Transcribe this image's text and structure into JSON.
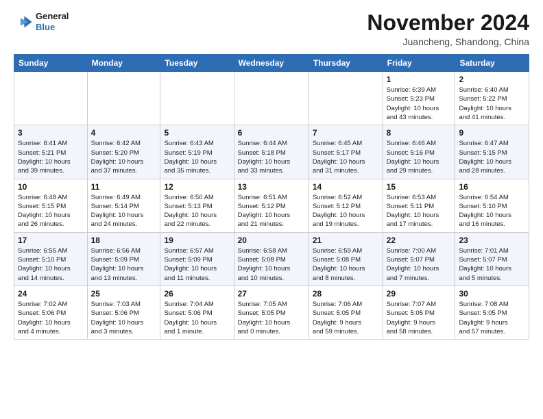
{
  "logo": {
    "line1": "General",
    "line2": "Blue"
  },
  "header": {
    "month": "November 2024",
    "location": "Juancheng, Shandong, China"
  },
  "weekdays": [
    "Sunday",
    "Monday",
    "Tuesday",
    "Wednesday",
    "Thursday",
    "Friday",
    "Saturday"
  ],
  "weeks": [
    [
      {
        "day": "",
        "info": ""
      },
      {
        "day": "",
        "info": ""
      },
      {
        "day": "",
        "info": ""
      },
      {
        "day": "",
        "info": ""
      },
      {
        "day": "",
        "info": ""
      },
      {
        "day": "1",
        "info": "Sunrise: 6:39 AM\nSunset: 5:23 PM\nDaylight: 10 hours\nand 43 minutes."
      },
      {
        "day": "2",
        "info": "Sunrise: 6:40 AM\nSunset: 5:22 PM\nDaylight: 10 hours\nand 41 minutes."
      }
    ],
    [
      {
        "day": "3",
        "info": "Sunrise: 6:41 AM\nSunset: 5:21 PM\nDaylight: 10 hours\nand 39 minutes."
      },
      {
        "day": "4",
        "info": "Sunrise: 6:42 AM\nSunset: 5:20 PM\nDaylight: 10 hours\nand 37 minutes."
      },
      {
        "day": "5",
        "info": "Sunrise: 6:43 AM\nSunset: 5:19 PM\nDaylight: 10 hours\nand 35 minutes."
      },
      {
        "day": "6",
        "info": "Sunrise: 6:44 AM\nSunset: 5:18 PM\nDaylight: 10 hours\nand 33 minutes."
      },
      {
        "day": "7",
        "info": "Sunrise: 6:45 AM\nSunset: 5:17 PM\nDaylight: 10 hours\nand 31 minutes."
      },
      {
        "day": "8",
        "info": "Sunrise: 6:46 AM\nSunset: 5:16 PM\nDaylight: 10 hours\nand 29 minutes."
      },
      {
        "day": "9",
        "info": "Sunrise: 6:47 AM\nSunset: 5:15 PM\nDaylight: 10 hours\nand 28 minutes."
      }
    ],
    [
      {
        "day": "10",
        "info": "Sunrise: 6:48 AM\nSunset: 5:15 PM\nDaylight: 10 hours\nand 26 minutes."
      },
      {
        "day": "11",
        "info": "Sunrise: 6:49 AM\nSunset: 5:14 PM\nDaylight: 10 hours\nand 24 minutes."
      },
      {
        "day": "12",
        "info": "Sunrise: 6:50 AM\nSunset: 5:13 PM\nDaylight: 10 hours\nand 22 minutes."
      },
      {
        "day": "13",
        "info": "Sunrise: 6:51 AM\nSunset: 5:12 PM\nDaylight: 10 hours\nand 21 minutes."
      },
      {
        "day": "14",
        "info": "Sunrise: 6:52 AM\nSunset: 5:12 PM\nDaylight: 10 hours\nand 19 minutes."
      },
      {
        "day": "15",
        "info": "Sunrise: 6:53 AM\nSunset: 5:11 PM\nDaylight: 10 hours\nand 17 minutes."
      },
      {
        "day": "16",
        "info": "Sunrise: 6:54 AM\nSunset: 5:10 PM\nDaylight: 10 hours\nand 16 minutes."
      }
    ],
    [
      {
        "day": "17",
        "info": "Sunrise: 6:55 AM\nSunset: 5:10 PM\nDaylight: 10 hours\nand 14 minutes."
      },
      {
        "day": "18",
        "info": "Sunrise: 6:56 AM\nSunset: 5:09 PM\nDaylight: 10 hours\nand 13 minutes."
      },
      {
        "day": "19",
        "info": "Sunrise: 6:57 AM\nSunset: 5:09 PM\nDaylight: 10 hours\nand 11 minutes."
      },
      {
        "day": "20",
        "info": "Sunrise: 6:58 AM\nSunset: 5:08 PM\nDaylight: 10 hours\nand 10 minutes."
      },
      {
        "day": "21",
        "info": "Sunrise: 6:59 AM\nSunset: 5:08 PM\nDaylight: 10 hours\nand 8 minutes."
      },
      {
        "day": "22",
        "info": "Sunrise: 7:00 AM\nSunset: 5:07 PM\nDaylight: 10 hours\nand 7 minutes."
      },
      {
        "day": "23",
        "info": "Sunrise: 7:01 AM\nSunset: 5:07 PM\nDaylight: 10 hours\nand 5 minutes."
      }
    ],
    [
      {
        "day": "24",
        "info": "Sunrise: 7:02 AM\nSunset: 5:06 PM\nDaylight: 10 hours\nand 4 minutes."
      },
      {
        "day": "25",
        "info": "Sunrise: 7:03 AM\nSunset: 5:06 PM\nDaylight: 10 hours\nand 3 minutes."
      },
      {
        "day": "26",
        "info": "Sunrise: 7:04 AM\nSunset: 5:06 PM\nDaylight: 10 hours\nand 1 minute."
      },
      {
        "day": "27",
        "info": "Sunrise: 7:05 AM\nSunset: 5:05 PM\nDaylight: 10 hours\nand 0 minutes."
      },
      {
        "day": "28",
        "info": "Sunrise: 7:06 AM\nSunset: 5:05 PM\nDaylight: 9 hours\nand 59 minutes."
      },
      {
        "day": "29",
        "info": "Sunrise: 7:07 AM\nSunset: 5:05 PM\nDaylight: 9 hours\nand 58 minutes."
      },
      {
        "day": "30",
        "info": "Sunrise: 7:08 AM\nSunset: 5:05 PM\nDaylight: 9 hours\nand 57 minutes."
      }
    ]
  ]
}
